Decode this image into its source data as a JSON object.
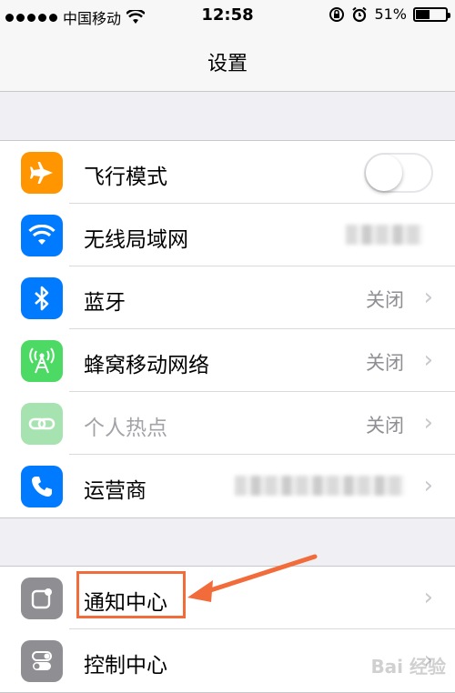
{
  "statusbar": {
    "carrier": "中国移动",
    "time": "12:58",
    "battery": "51%",
    "battery_level": 0.51
  },
  "nav": {
    "title": "设置"
  },
  "section1": {
    "airplane": {
      "label": "飞行模式",
      "icon": "airplane-icon",
      "color": "#ff9500",
      "toggle_on": false
    },
    "wifi": {
      "label": "无线局域网",
      "icon": "wifi-icon",
      "color": "#007aff"
    },
    "bluetooth": {
      "label": "蓝牙",
      "value": "关闭",
      "icon": "bluetooth-icon",
      "color": "#007aff"
    },
    "cellular": {
      "label": "蜂窝移动网络",
      "value": "关闭",
      "icon": "antenna-icon",
      "color": "#4cd964"
    },
    "hotspot": {
      "label": "个人热点",
      "value": "关闭",
      "icon": "hotspot-link-icon",
      "color": "#a6e3b0"
    },
    "carrier": {
      "label": "运营商",
      "icon": "phone-icon",
      "color": "#007aff"
    }
  },
  "section2": {
    "notification": {
      "label": "通知中心",
      "icon": "notification-center-icon",
      "color": "#8e8e93"
    },
    "control": {
      "label": "控制中心",
      "icon": "control-center-icon",
      "color": "#8e8e93"
    }
  },
  "annotation": {
    "color": "#f26b3a"
  },
  "watermark": "Bai 经验"
}
